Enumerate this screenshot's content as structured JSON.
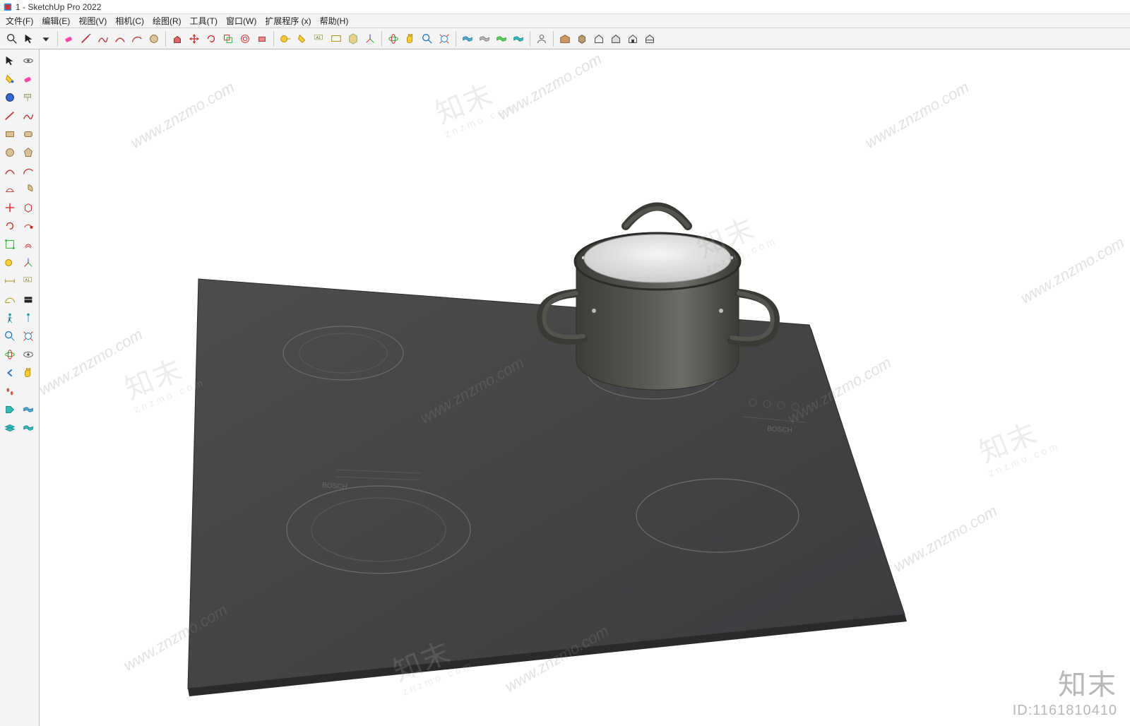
{
  "window": {
    "title": "1 - SketchUp Pro 2022"
  },
  "menus": [
    {
      "label": "文件(F)"
    },
    {
      "label": "编辑(E)"
    },
    {
      "label": "视图(V)"
    },
    {
      "label": "相机(C)"
    },
    {
      "label": "绘图(R)"
    },
    {
      "label": "工具(T)"
    },
    {
      "label": "窗口(W)"
    },
    {
      "label": "扩展程序 (x)"
    },
    {
      "label": "帮助(H)"
    }
  ],
  "top_toolbar_groups": [
    {
      "tools": [
        "search",
        "select",
        "dropdown"
      ]
    },
    {
      "tools": [
        "eraser",
        "pencil",
        "freehand",
        "arc",
        "arc2",
        "circle"
      ]
    },
    {
      "tools": [
        "pushpull",
        "move",
        "rotate",
        "scale",
        "offset",
        "followme"
      ]
    },
    {
      "tools": [
        "tape",
        "text",
        "dim",
        "axes",
        "protractor",
        "section"
      ]
    },
    {
      "tools": [
        "orbit",
        "pan",
        "zoom",
        "zoom-extents"
      ]
    },
    {
      "tools": [
        "layers-blue",
        "layers-gray",
        "layers-green",
        "layers-teal"
      ]
    },
    {
      "tools": [
        "user"
      ]
    },
    {
      "tools": [
        "warehouse",
        "component",
        "home1",
        "home2",
        "home3",
        "home4"
      ]
    }
  ],
  "side_toolbar": [
    "select",
    "orbit",
    "paint",
    "eraser",
    "solid1",
    "paint-roller",
    "line",
    "freehand",
    "rect",
    "rrect",
    "circle",
    "poly",
    "arc1",
    "arc2",
    "arc3",
    "pie",
    "move",
    "component-red",
    "rotate",
    "followme",
    "scale-green",
    "offset",
    "tape",
    "axes",
    "dim-arrow",
    "text-a",
    "protractor2",
    "section2",
    "head",
    "walk",
    "zoom-mag",
    "zoom-extents2",
    "orbit2",
    "pan2",
    "look",
    "position",
    "sandbox1",
    "sandbox2",
    "tag",
    "layers-blue2",
    "layers-teal2",
    ""
  ],
  "watermark": {
    "text_url": "www.znzmo.com",
    "text_cn_big": "知末",
    "text_cn_small": "znzmo.com"
  },
  "branding": {
    "name": "知末",
    "id_label": "ID:1161810410"
  },
  "model_text": {
    "brand1": "BOSCH",
    "brand2": "BOSCH"
  }
}
